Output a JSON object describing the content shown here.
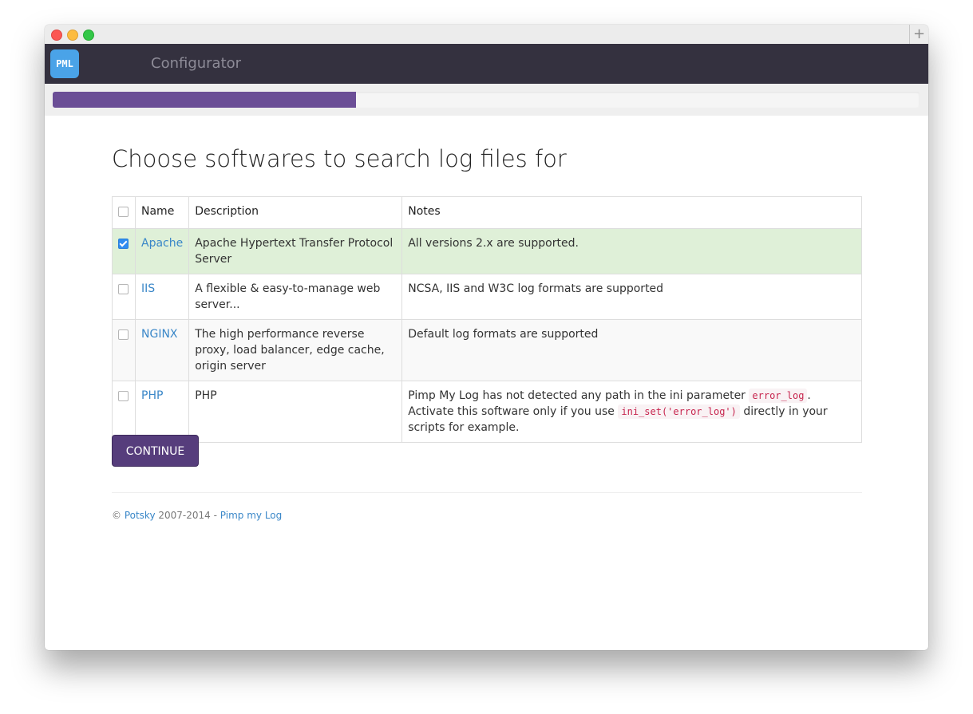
{
  "window": {
    "newtab_symbol": "+"
  },
  "navbar": {
    "logo_text": "PML",
    "brand": "Configurator"
  },
  "progress": {
    "percent": 35,
    "color": "#6b4e96"
  },
  "page": {
    "title": "Choose softwares to search log files for"
  },
  "table": {
    "headers": {
      "name": "Name",
      "description": "Description",
      "notes": "Notes"
    },
    "rows": [
      {
        "name": "Apache",
        "description": "Apache Hypertext Transfer Protocol Server",
        "notes": "All versions 2.x are supported.",
        "checked": true
      },
      {
        "name": "IIS",
        "description": "A flexible & easy-to-manage web server...",
        "notes": "NCSA, IIS and W3C log formats are supported",
        "checked": false
      },
      {
        "name": "NGINX",
        "description": "The high performance reverse proxy, load balancer, edge cache, origin server",
        "notes": "Default log formats are supported",
        "checked": false
      },
      {
        "name": "PHP",
        "description": "PHP",
        "checked": false,
        "notes_parts": {
          "a": "Pimp My Log has not detected any path in the ini parameter ",
          "code1": "error_log",
          "b": ". Activate this software only if you use ",
          "code2": "ini_set('error_log')",
          "c": " directly in your scripts for example."
        }
      }
    ]
  },
  "continue_button": "CONTINUE",
  "footer": {
    "copyright": "©",
    "author": "Potsky",
    "years": "2007-2014 -",
    "project": "Pimp my Log"
  }
}
